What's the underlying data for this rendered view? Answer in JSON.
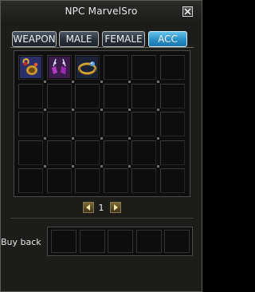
{
  "window": {
    "title": "NPC MarvelSro"
  },
  "tabs": [
    {
      "label": "WEAPON",
      "active": false
    },
    {
      "label": "MALE",
      "active": false
    },
    {
      "label": "FEMALE",
      "active": false
    },
    {
      "label": "ACC",
      "active": true
    }
  ],
  "grid": {
    "rows": 5,
    "cols": 6,
    "items": [
      {
        "slot": 0,
        "icon": "earring-icon"
      },
      {
        "slot": 1,
        "icon": "necklace-icon"
      },
      {
        "slot": 2,
        "icon": "ring-icon"
      }
    ]
  },
  "pager": {
    "page": "1"
  },
  "buyback": {
    "label": "Buy back",
    "slots": 5
  },
  "colors": {
    "active_tab": "#2a8fc6",
    "inactive_tab": "#27303a",
    "window_bg": "#1c1c1b",
    "slot_bg": "#0d0d0d"
  }
}
